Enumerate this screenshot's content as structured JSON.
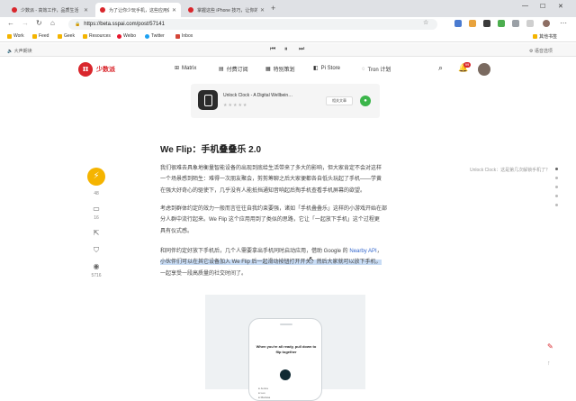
{
  "browser": {
    "tabs": [
      {
        "title": "少数派 - 高效工作，品质生活",
        "active": false
      },
      {
        "title": "为了让你少玩手机，这些应用做出了",
        "active": true
      },
      {
        "title": "掌握这些 iPhone 技巧，让你的iPh",
        "active": false
      }
    ],
    "new_tab_label": "+",
    "url": "https://beta.sspai.com/post/57141",
    "bookmarks": [
      "Work",
      "Feed",
      "Geek",
      "Resources",
      "Weibo",
      "Twitter",
      "Inbox"
    ],
    "other_bookmarks": "其他书签"
  },
  "reader_bar": {
    "left_label": "大声朗读",
    "prev": "⏮",
    "pause": "⏸",
    "next": "⏭",
    "right_label": "语音选项"
  },
  "site_nav": {
    "logo_glyph": "π",
    "logo_text": "少数派",
    "items": [
      {
        "icon": "⊞",
        "label": "Matrix"
      },
      {
        "icon": "▤",
        "label": "付费订阅"
      },
      {
        "icon": "▦",
        "label": "特别策划"
      },
      {
        "icon": "◧",
        "label": "Pi Store"
      },
      {
        "icon": "◌",
        "label": "Tron 计划"
      }
    ],
    "notification_count": "99"
  },
  "app_card": {
    "name": "Unlock Clock - A Digital Wellbein…",
    "stars": "★★★★★",
    "related_label": "相关文章"
  },
  "article": {
    "heading": "We Flip：手机叠叠乐 2.0",
    "paragraph1": [
      "我们很难去具象地衡量智能设备的出现到底给生活带来了多大的影响，但大家肯定不会对这样",
      "一个场景感到陌生：难得一次朋友聚会，剪剪筹聊之后大家便都各自低头玩起了手机——学黄",
      "在强大好奇心的驱使下，几乎没有人能抵挡通知音响起后掏手机查看手机屏幕的欲望。"
    ],
    "paragraph2": [
      "考虑到群体约定的效力一般而言往往自我约束要强，诸如「手机叠叠乐」这样的小游戏开始在部",
      "分人群中流行起来。We Flip 这个应用用到了类似的思路，它让「一起放下手机」这个过程更",
      "具有仪式感。"
    ],
    "paragraph3_line1_pre": "和同伴约定好放下手机后，几个人需要拿出手机同时启动应用，借助 Google 的 ",
    "paragraph3_link": "Nearby API",
    "paragraph3_line1_post": "，",
    "paragraph3_line2_hl": "小伙伴们可以在其它设备加入 We Flip 后一起滑动按钮打开开关。然后大家就可以放下手机，",
    "paragraph3_line3": "一起享受一段高质量的社交时间了。"
  },
  "side": {
    "ai_label": "⚡",
    "likes": "48",
    "comments": "16",
    "views": "5716"
  },
  "toc": {
    "label": "Unlock Clock：这是第几次解锁手机了？"
  },
  "figure": {
    "phone_text": "When you're all ready, pull down to flip together",
    "list": [
      "● Jenna",
      "● Leo",
      "● Marissa"
    ]
  }
}
